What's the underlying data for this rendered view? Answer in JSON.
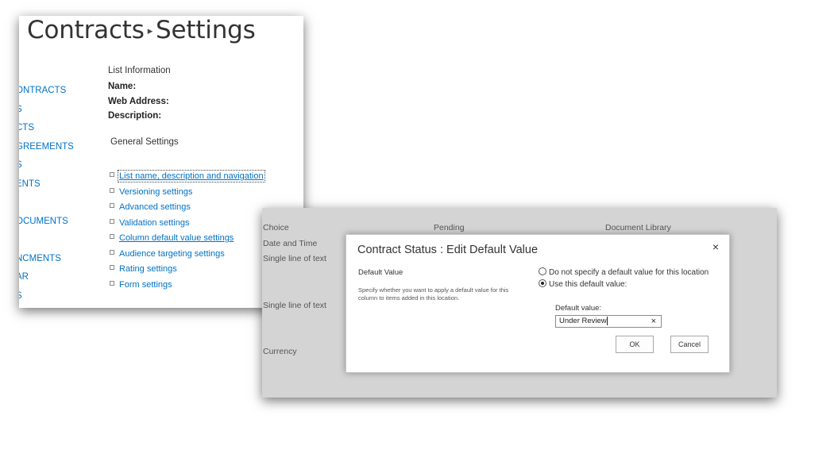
{
  "settings_page": {
    "breadcrumb": {
      "site": "Contracts",
      "separator": "▸",
      "page": "Settings"
    },
    "quick_launch": [
      "ONTRACTS",
      "S",
      "CTS",
      "GREEMENTS",
      "S",
      "ENTS",
      "OCUMENTS",
      "NCMENTS",
      "AR",
      "S"
    ],
    "list_information": {
      "heading": "List Information",
      "name_label": "Name:",
      "web_address_label": "Web Address:",
      "description_label": "Description:"
    },
    "general_settings": {
      "heading": "General Settings",
      "links": [
        "List name, description and navigation",
        "Versioning settings",
        "Advanced settings",
        "Validation settings",
        "Column default value settings",
        "Audience targeting settings",
        "Rating settings",
        "Form settings"
      ]
    }
  },
  "background_table": {
    "col1": [
      "Choice",
      "Date and Time",
      "Single line of text",
      "Single line of text",
      "Currency"
    ],
    "col2": [
      "Pending"
    ],
    "col3": [
      "Document Library"
    ]
  },
  "dialog": {
    "title": "Contract Status : Edit Default Value",
    "close_glyph": "×",
    "section_label": "Default Value",
    "section_description": "Specify whether you want to apply a default value for this column to items added in this location.",
    "option_no_default": "Do not specify a default value for this location",
    "option_use_default": "Use this default value:",
    "selected_option": "use_default",
    "default_value_label": "Default value:",
    "default_value": "Under Review",
    "clear_glyph": "×",
    "ok_label": "OK",
    "cancel_label": "Cancel"
  },
  "colors": {
    "link": "#0072c6",
    "overlay_gray": "#d4d4d4"
  }
}
